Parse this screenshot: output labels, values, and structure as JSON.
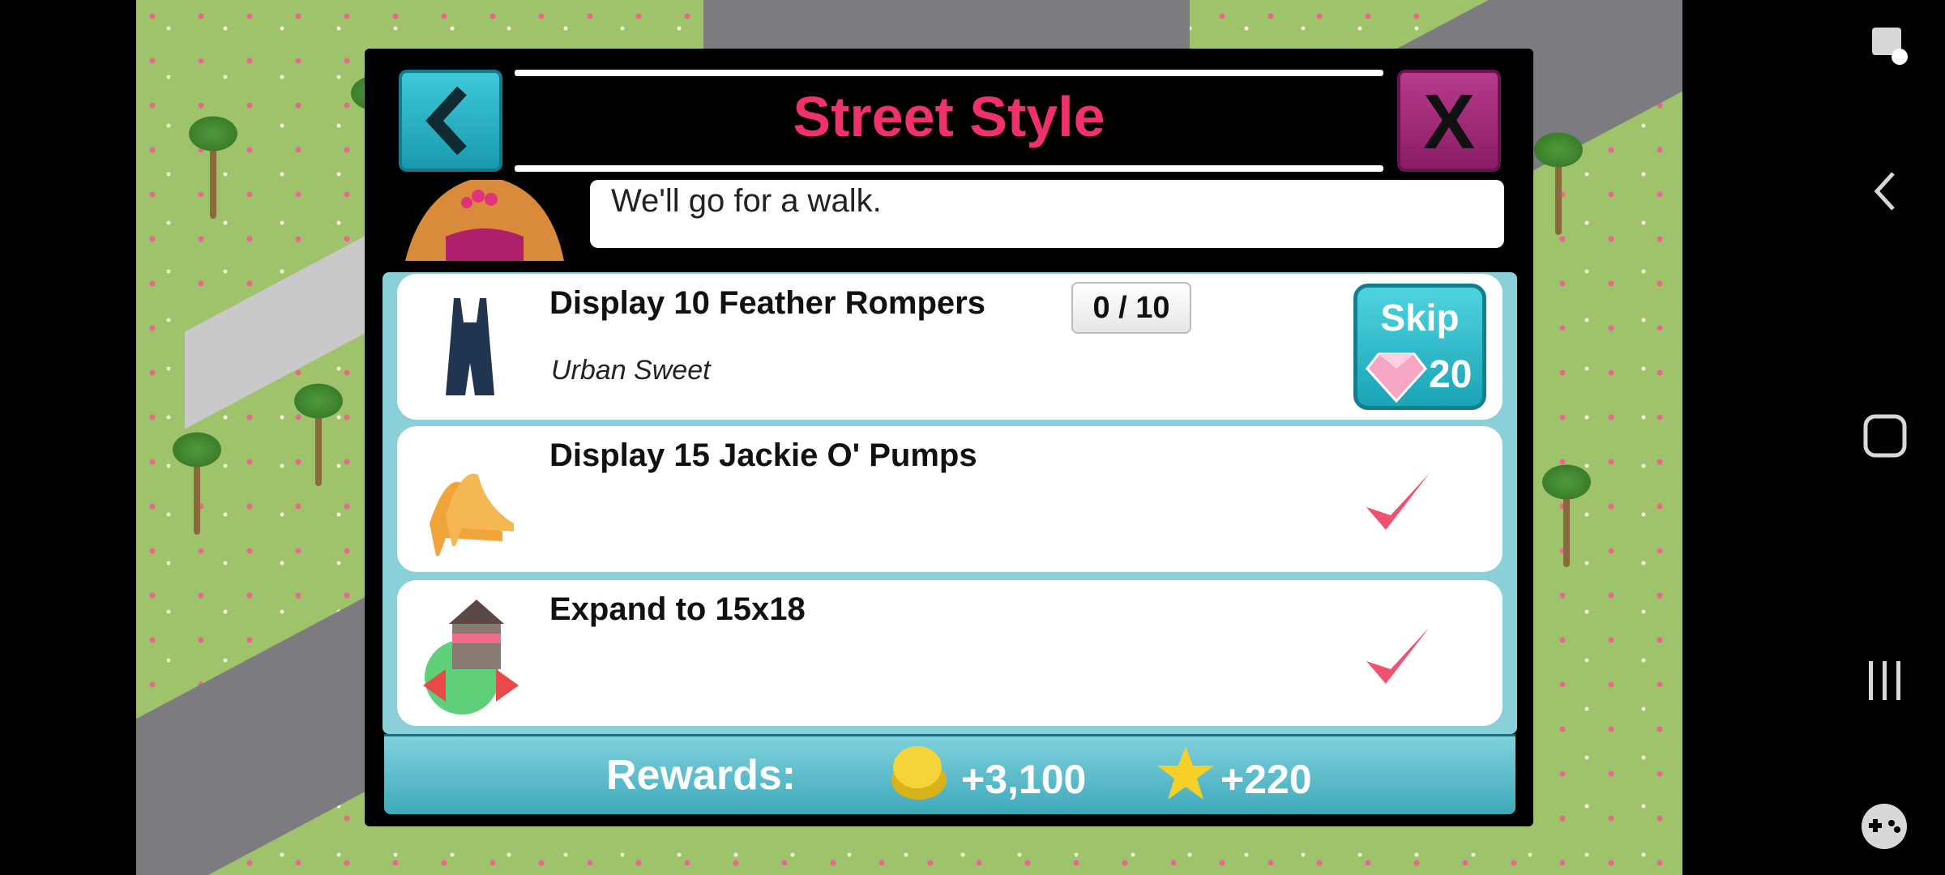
{
  "dialog": {
    "title": "Street Style",
    "close_label": "X",
    "speech": "We'll go for a walk."
  },
  "tasks": [
    {
      "title": "Display 10 Feather Rompers",
      "subtitle": "Urban Sweet",
      "progress": "0 / 10",
      "icon": "romper-icon",
      "completed": false
    },
    {
      "title": "Display 15 Jackie O' Pumps",
      "icon": "pumps-icon",
      "completed": true
    },
    {
      "title": "Expand to 15x18",
      "icon": "expand-store-icon",
      "completed": true
    }
  ],
  "skip": {
    "label": "Skip",
    "cost": "20",
    "icon": "gem-icon"
  },
  "rewards": {
    "label": "Rewards:",
    "coins": "+3,100",
    "stars": "+220"
  },
  "colors": {
    "title": "#f0316b",
    "back_button": "#2bb5c7",
    "close_button": "#a42d7c",
    "check": "#f0516f",
    "panel": "#8bd0d8"
  }
}
